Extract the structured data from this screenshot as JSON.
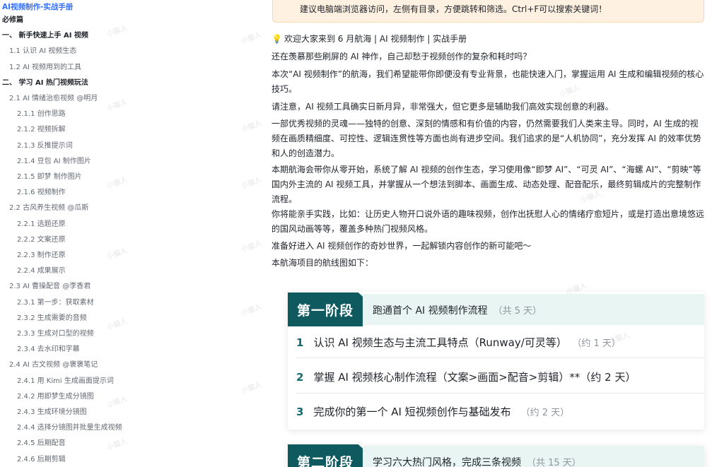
{
  "toc": {
    "title": "AI视频制作-实战手册",
    "items": [
      {
        "label": "必修篇",
        "level": 0
      },
      {
        "label": "一、 新手快速上手 AI 视频",
        "level": 1
      },
      {
        "label": "1.1 认识 AI 视频生态",
        "level": 2
      },
      {
        "label": "1.2 AI 视频用到的工具",
        "level": 2
      },
      {
        "label": "二、 学习 AI 热门视频玩法",
        "level": 1
      },
      {
        "label": "2.1 AI 情绪治愈视频 @明月",
        "level": 2
      },
      {
        "label": "2.1.1 创作思路",
        "level": 3
      },
      {
        "label": "2.1.2 视频拆解",
        "level": 3
      },
      {
        "label": "2.1.3 反推提示词",
        "level": 3
      },
      {
        "label": "2.1.4 豆包 AI 制作图片",
        "level": 3
      },
      {
        "label": "2.1.5 即梦 制作图片",
        "level": 3
      },
      {
        "label": "2.1.6 视频制作",
        "level": 3
      },
      {
        "label": "2.2 古风养生视频 @瓜斯",
        "level": 2
      },
      {
        "label": "2.2.1 选题还原",
        "level": 3
      },
      {
        "label": "2.2.2 文案还原",
        "level": 3
      },
      {
        "label": "2.2.3 制作还原",
        "level": 3
      },
      {
        "label": "2.2.4 成果展示",
        "level": 3
      },
      {
        "label": "2.3 AI 曹操配音 @李香君",
        "level": 2
      },
      {
        "label": "2.3.1 第一步：获取素材",
        "level": 3
      },
      {
        "label": "2.3.2 生成需要的音频",
        "level": 3
      },
      {
        "label": "2.3.3 生成对口型的视频",
        "level": 3
      },
      {
        "label": "2.3.4 去水印和字幕",
        "level": 3
      },
      {
        "label": "2.4 AI 古文视频 @褒褒笔记",
        "level": 2
      },
      {
        "label": "2.4.1 用 Kimi 生成画面提示词",
        "level": 3
      },
      {
        "label": "2.4.2 用即梦生成分镜图",
        "level": 3
      },
      {
        "label": "2.4.3 生成环境分镜图",
        "level": 3
      },
      {
        "label": "2.4.4 选择分镜图并批量生成视频",
        "level": 3
      },
      {
        "label": "2.4.5 后期配音",
        "level": 3
      },
      {
        "label": "2.4.6 后期剪辑",
        "level": 3
      }
    ]
  },
  "tip": "建议电脑端浏览器访问，左侧有目录，方便跳转和筛选。Ctrl+F可以搜索关键词！",
  "article": {
    "welcome": "欢迎大家来到 6 月航海 | AI 视频制作 | 实战手册",
    "p1": "还在羡慕那些刷屏的 AI 神作，自己却愁于视频创作的复杂和耗时吗？",
    "p2": "本次“AI 视频制作”的航海，我们希望能带你即便没有专业背景，也能快速入门，掌握运用 AI 生成和编辑视频的核心技巧。",
    "p3": "请注意，AI 视频工具确实日新月异，非常强大，但它更多是辅助我们高效实现创意的利器。",
    "p4": "一部优秀视频的灵魂——独特的创意、深刻的情感和有价值的内容，仍然需要我们人类来主导。同时，AI 生成的视频在画质精细度、可控性、逻辑连贯性等方面也尚有进步空间。我们追求的是“人机协同”，充分发挥 AI 的效率优势和人的创造潜力。",
    "p5": "本期航海会带你从零开始，系统了解 AI 视频的创作生态，学习使用像“即梦 AI”、“可灵 AI”、“海螺 AI”、“剪映”等国内外主流的 AI 视频工具，并掌握从一个想法到脚本、画面生成、动态处理、配音配乐，最终剪辑成片的完整制作流程。",
    "p6": "你将能亲手实践，比如：让历史人物开口说外语的趣味视频，创作出抚慰人心的情绪疗愈短片，或是打造出意境悠远的国风动画等等，覆盖多种热门视频风格。",
    "p7": "准备好进入 AI 视频创作的奇妙世界，一起解锁内容创作的新可能吧～",
    "p8": "本航海项目的航线图如下："
  },
  "roadmap": {
    "stage1": {
      "badge": "第一阶段",
      "title": "跑通首个 AI 视频制作流程",
      "days": "（共 5 天）",
      "tasks": [
        {
          "num": "1",
          "text": "认识 AI 视频生态与主流工具特点（Runway/可灵等）",
          "days": "（约 1 天）"
        },
        {
          "num": "2",
          "text": "掌握 AI 视频核心制作流程（文案>画面>配音>剪辑）**（约 2 天）",
          "days": ""
        },
        {
          "num": "3",
          "text": "完成你的第一个 AI 短视频创作与基础发布",
          "days": "（约 2 天）"
        }
      ]
    },
    "stage2": {
      "badge": "第二阶段",
      "title": "学习六大热门风格，完成三条视频",
      "days": "（共 15 天）"
    }
  },
  "watermark": "小猫人",
  "colors": {
    "accent": "#3370ff",
    "stage_badge": "#0f5a5e",
    "stage_bg": "#e8f5f3",
    "tip_bg": "#fef1e1"
  }
}
